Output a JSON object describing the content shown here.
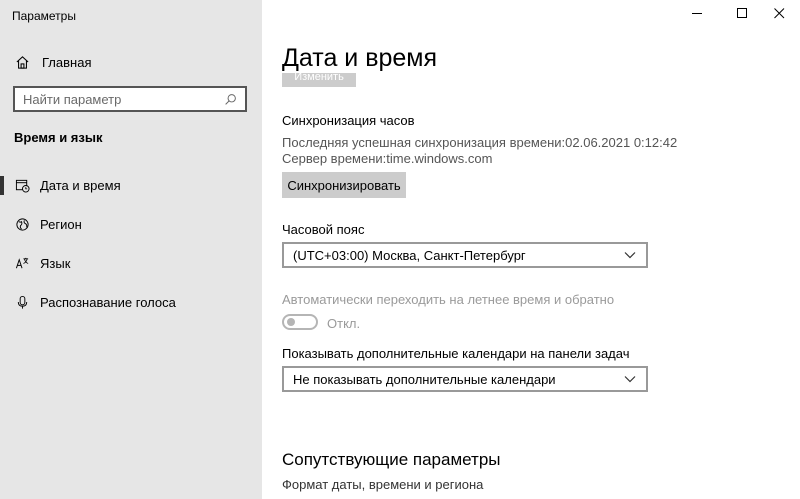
{
  "window": {
    "title": "Параметры",
    "minimize_icon": "minimize-icon",
    "maximize_icon": "maximize-icon",
    "close_icon": "close-icon"
  },
  "sidebar": {
    "home_label": "Главная",
    "search_placeholder": "Найти параметр",
    "section_title": "Время и язык",
    "items": [
      {
        "label": "Дата и время",
        "icon": "calendar-clock-icon",
        "active": true
      },
      {
        "label": "Регион",
        "icon": "globe-icon",
        "active": false
      },
      {
        "label": "Язык",
        "icon": "language-icon",
        "active": false
      },
      {
        "label": "Распознавание голоса",
        "icon": "microphone-icon",
        "active": false
      }
    ]
  },
  "main": {
    "title": "Дата и время",
    "change_button_label": "Изменить",
    "sync": {
      "heading": "Синхронизация часов",
      "last_sync": "Последняя успешная синхронизация времени:02.06.2021 0:12:42",
      "server": "Сервер времени:time.windows.com",
      "button_label": "Синхронизировать"
    },
    "timezone": {
      "label": "Часовой пояс",
      "selected": "(UTC+03:00) Москва, Санкт-Петербург"
    },
    "dst": {
      "label": "Автоматически переходить на летнее время и обратно",
      "state_label": "Откл."
    },
    "calendars": {
      "label": "Показывать дополнительные календари на панели задач",
      "selected": "Не показывать дополнительные календари"
    },
    "related": {
      "heading": "Сопутствующие параметры",
      "link": "Формат даты, времени и региона"
    }
  }
}
